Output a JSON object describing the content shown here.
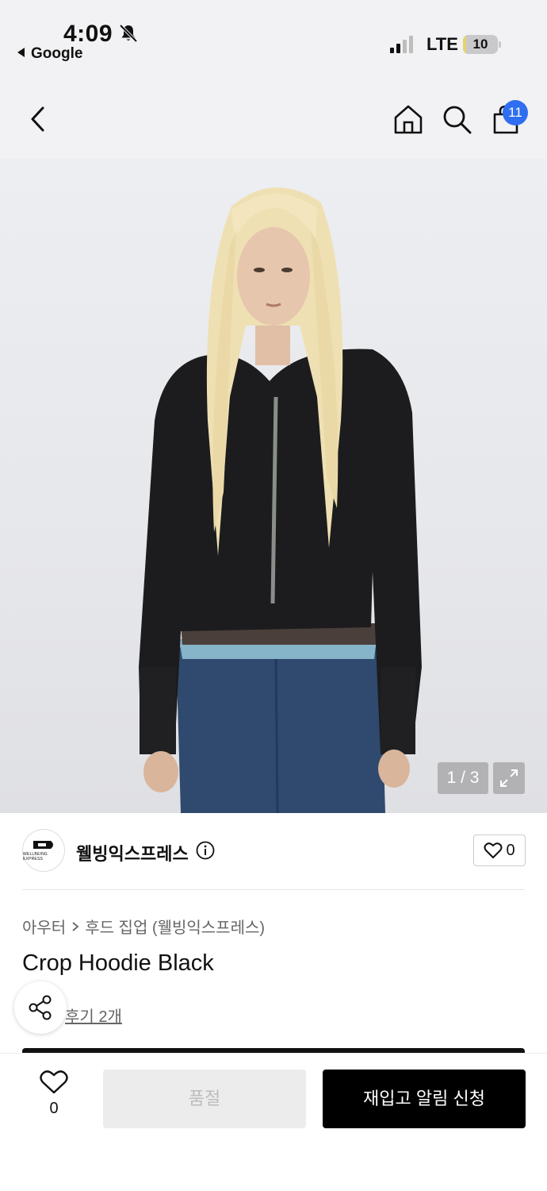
{
  "status_bar": {
    "time": "4:09",
    "back_app": "Google",
    "network": "LTE",
    "battery": "10",
    "battery_fraction": 0.1
  },
  "nav": {
    "cart_count": "11",
    "icons": [
      "back-chevron-icon",
      "home-icon",
      "search-icon",
      "shopping-bag-icon"
    ]
  },
  "gallery": {
    "counter": "1 / 3"
  },
  "brand": {
    "name": "웰빙익스프레스",
    "logo_text": "WELLBEING EXPRESS",
    "like_count": "0"
  },
  "product": {
    "breadcrumb": [
      "아우터",
      "후드 집업 (웰빙익스프레스)"
    ],
    "title": "Crop Hoodie Black",
    "review_text": "후기 2개"
  },
  "actions": {
    "wish_count": "0",
    "soldout_label": "품절",
    "restock_label": "재입고 알림 신청"
  }
}
